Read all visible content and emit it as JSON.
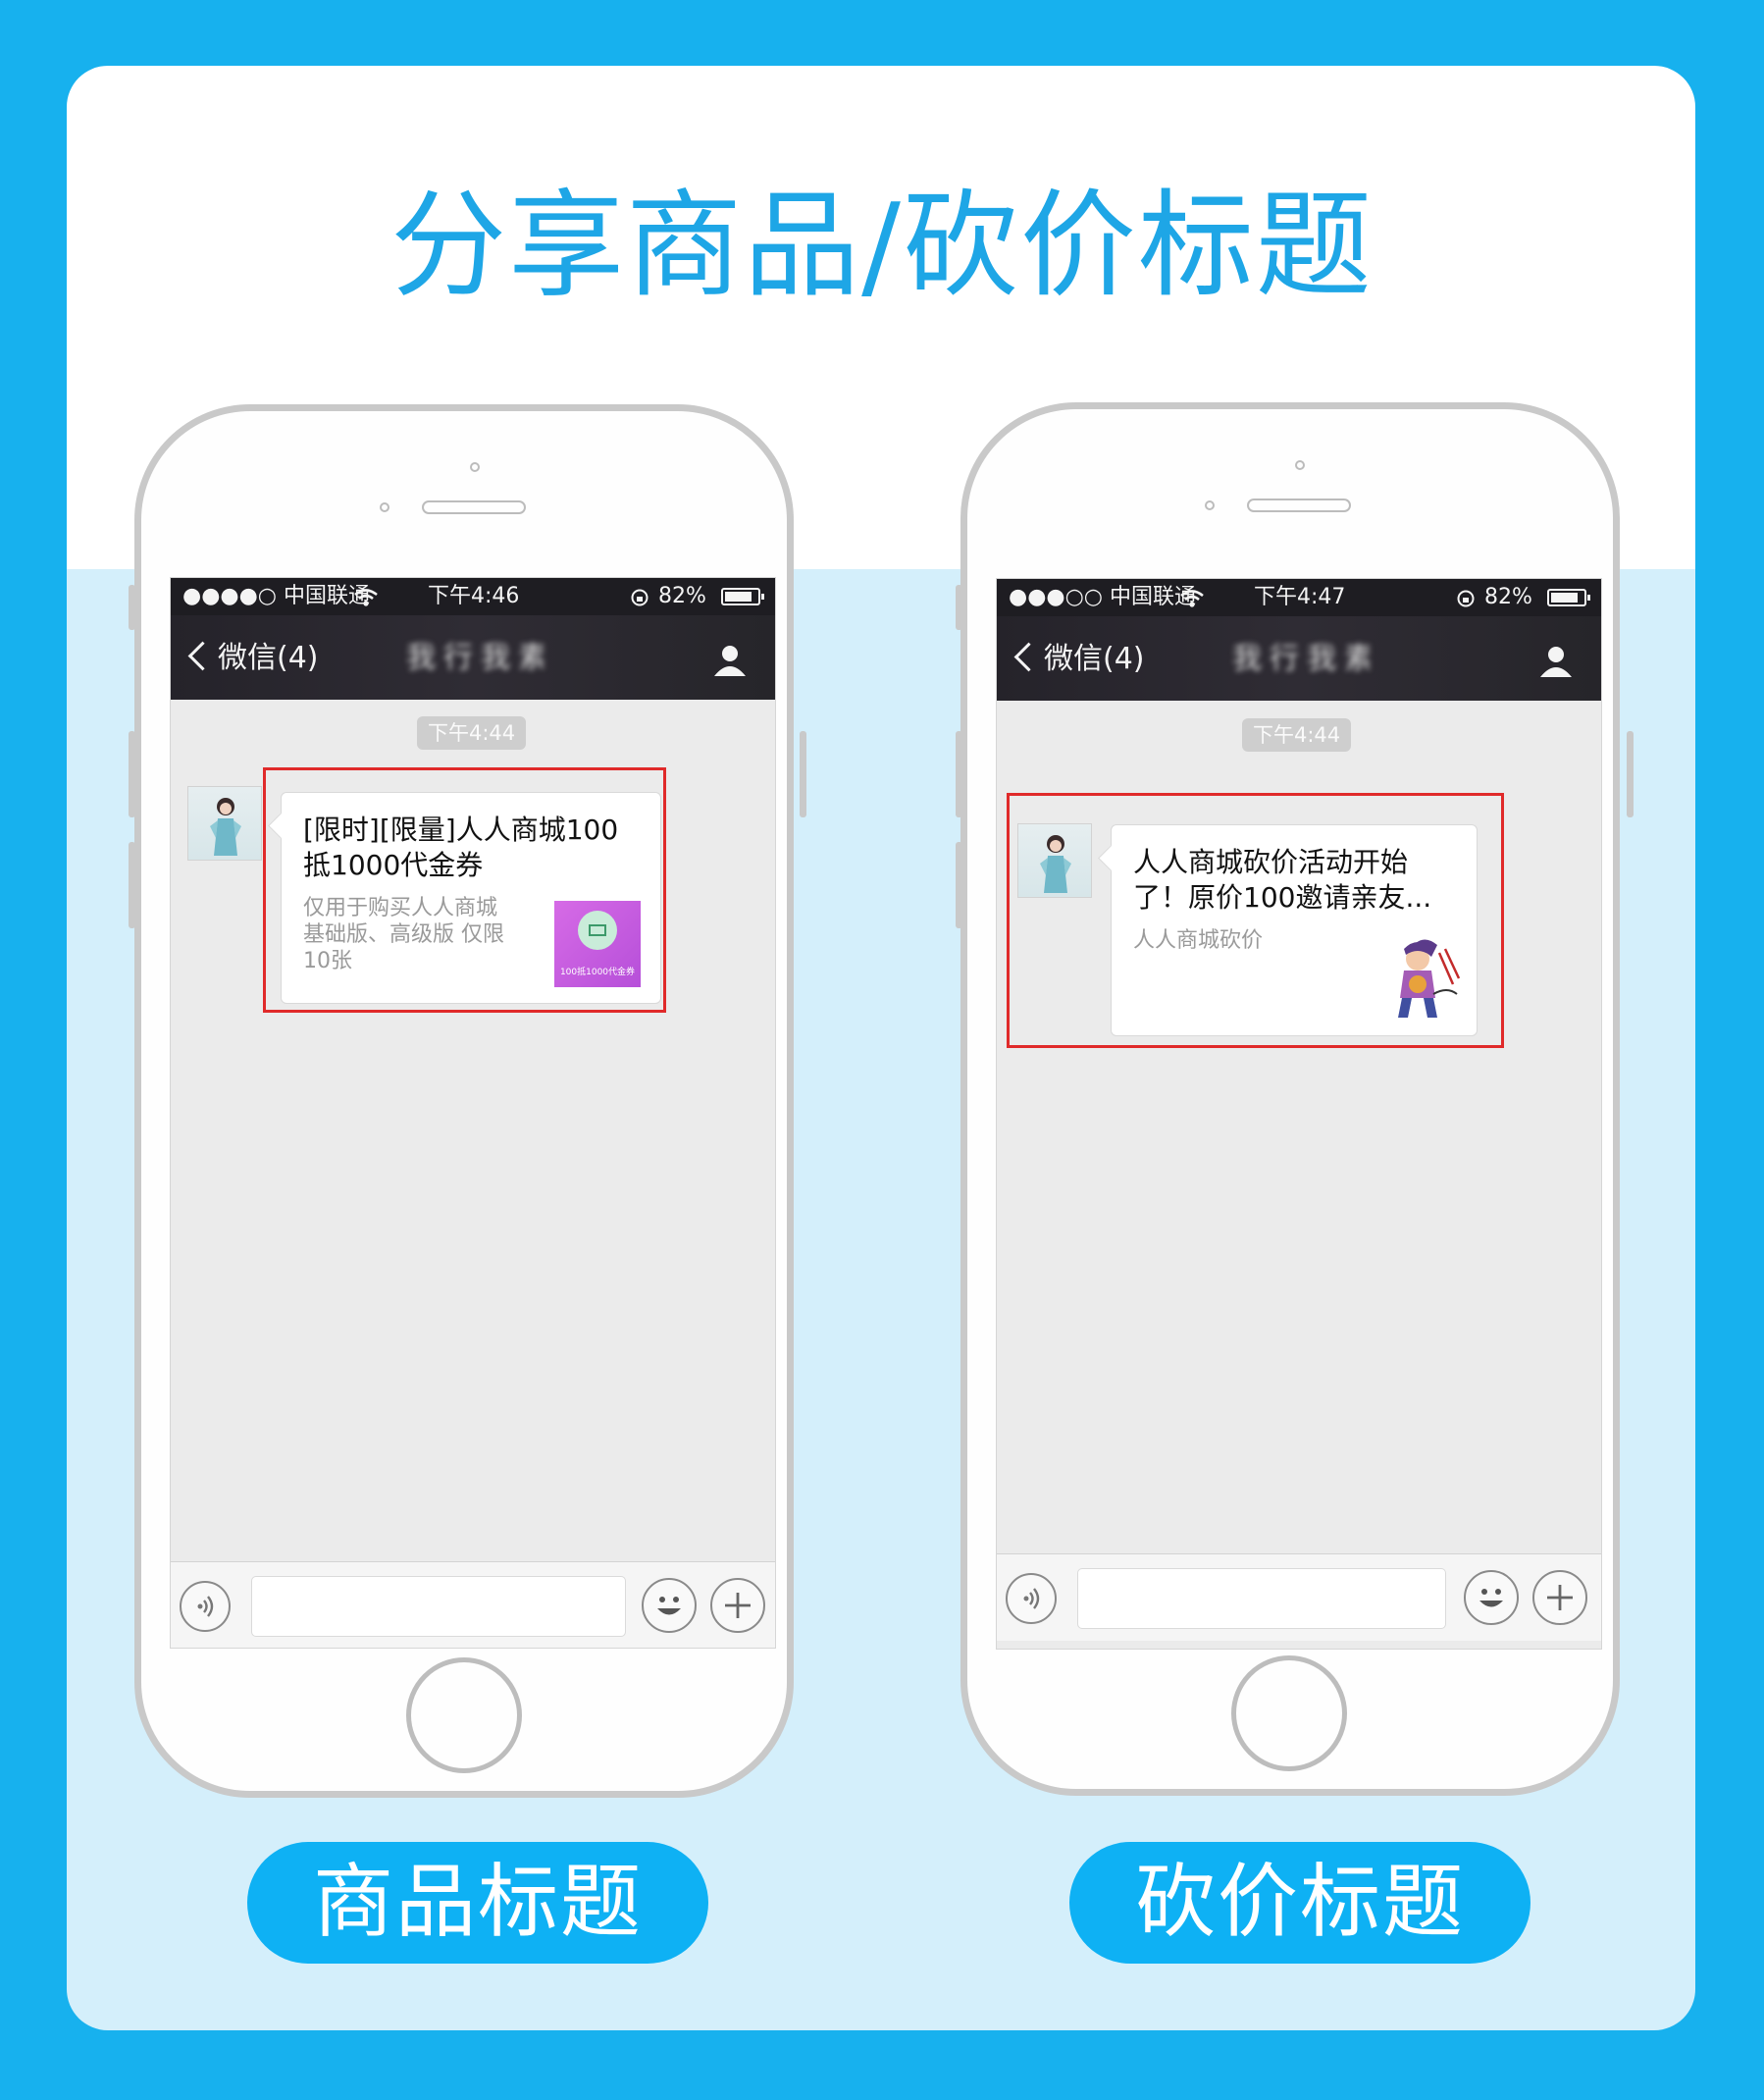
{
  "headline": "分享商品/砍价标题",
  "phones": [
    {
      "status": {
        "carrier": "●●●●○ 中国联通",
        "time": "下午4:46",
        "battery": "82%"
      },
      "nav": {
        "back": "微信(4)",
        "title": "我行我素"
      },
      "timestamp": "下午4:44",
      "card": {
        "title_line1": "[限时][限量]人人商城100",
        "title_line2": "抵1000代金券",
        "desc_line1": "仅用于购买人人商城",
        "desc_line2": "基础版、高级版 仅限",
        "desc_line3": "10张",
        "thumb_caption": "100抵1000代金券"
      },
      "label": "商品标题"
    },
    {
      "status": {
        "carrier": "●●●○○ 中国联通",
        "time": "下午4:47",
        "battery": "82%"
      },
      "nav": {
        "back": "微信(4)",
        "title": "我行我素"
      },
      "timestamp": "下午4:44",
      "card": {
        "title_line1": "人人商城砍价活动开始",
        "title_line2": "了！原价100邀请亲友...",
        "desc_line1": "人人商城砍价"
      },
      "label": "砍价标题"
    }
  ],
  "colors": {
    "accent": "#1ea6e6",
    "background": "#17b1ee",
    "highlight": "#e02a2a"
  },
  "icons": [
    "wifi-icon",
    "lock-rotation-icon",
    "battery-icon",
    "back-chevron-icon",
    "person-icon",
    "voice-icon",
    "emoji-icon",
    "plus-icon"
  ]
}
